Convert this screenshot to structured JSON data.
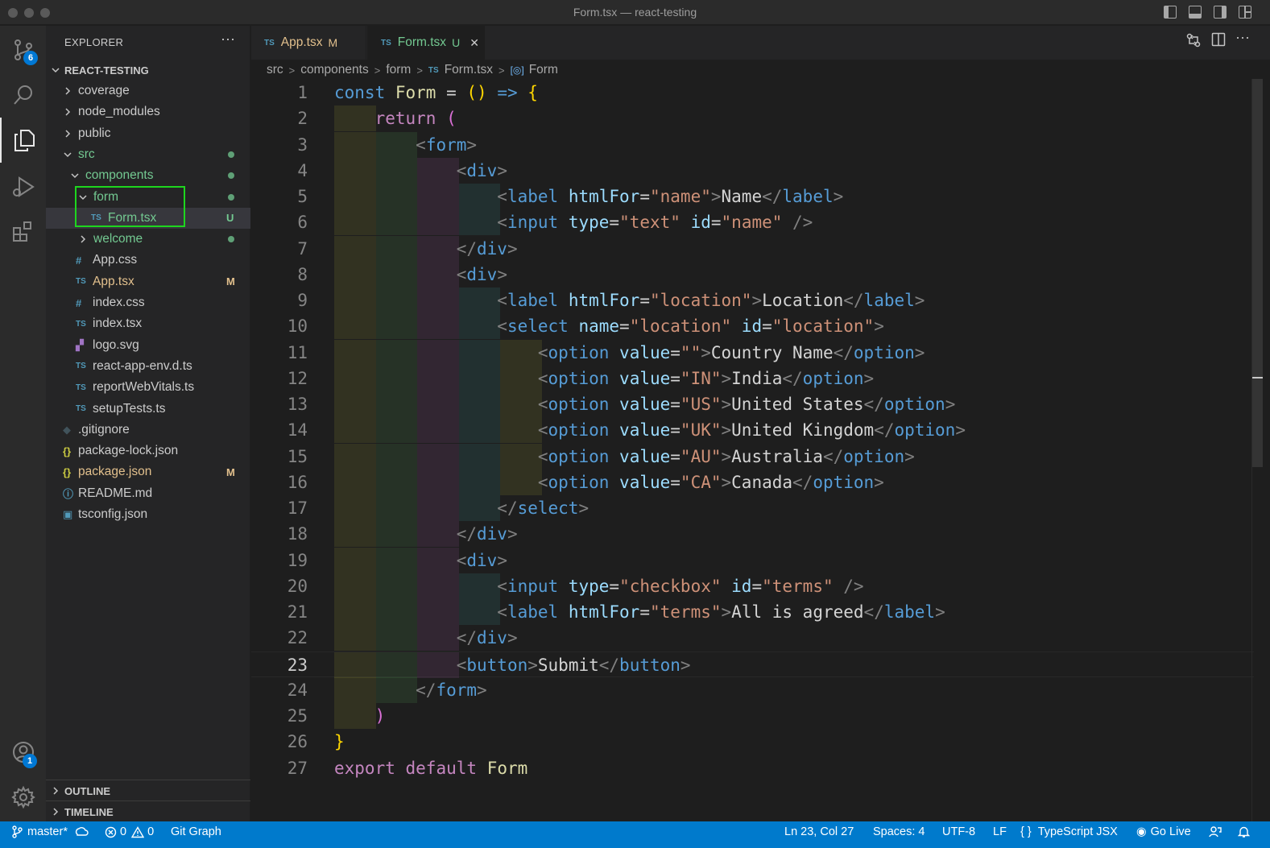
{
  "window": {
    "title": "Form.tsx — react-testing"
  },
  "activity_bar": {
    "items": [
      {
        "name": "source-control",
        "badge": "6"
      },
      {
        "name": "search"
      },
      {
        "name": "explorer"
      },
      {
        "name": "run-and-debug"
      },
      {
        "name": "extensions"
      },
      {
        "name": "accounts",
        "badge": "1"
      },
      {
        "name": "manage"
      }
    ]
  },
  "sidebar": {
    "header": "EXPLORER",
    "more": "···",
    "root": "REACT-TESTING",
    "tree": [
      {
        "label": "coverage",
        "type": "folder",
        "expanded": false,
        "depth": 1,
        "color": "#cccccc"
      },
      {
        "label": "node_modules",
        "type": "folder",
        "expanded": false,
        "depth": 1,
        "color": "#cccccc"
      },
      {
        "label": "public",
        "type": "folder",
        "expanded": false,
        "depth": 1,
        "color": "#cccccc"
      },
      {
        "label": "src",
        "type": "folder",
        "expanded": true,
        "depth": 1,
        "color": "#73c991",
        "dot": "#73c991"
      },
      {
        "label": "components",
        "type": "folder",
        "expanded": true,
        "depth": 2,
        "color": "#73c991",
        "dot": "#73c991"
      },
      {
        "label": "form",
        "type": "folder",
        "expanded": true,
        "depth": 3,
        "color": "#73c991",
        "dot": "#73c991"
      },
      {
        "label": "Form.tsx",
        "type": "ts",
        "depth": 4,
        "color": "#73c991",
        "status": "U",
        "status_color": "#73c991",
        "selected": true
      },
      {
        "label": "welcome",
        "type": "folder",
        "expanded": false,
        "depth": 3,
        "color": "#73c991",
        "dot": "#73c991"
      },
      {
        "label": "App.css",
        "type": "css",
        "depth": 2,
        "color": "#cccccc"
      },
      {
        "label": "App.tsx",
        "type": "ts",
        "depth": 2,
        "color": "#e2c08d",
        "status": "M",
        "status_color": "#e2c08d"
      },
      {
        "label": "index.css",
        "type": "css",
        "depth": 2,
        "color": "#cccccc"
      },
      {
        "label": "index.tsx",
        "type": "ts",
        "depth": 2,
        "color": "#cccccc"
      },
      {
        "label": "logo.svg",
        "type": "svg",
        "depth": 2,
        "color": "#cccccc"
      },
      {
        "label": "react-app-env.d.ts",
        "type": "ts",
        "depth": 2,
        "color": "#cccccc"
      },
      {
        "label": "reportWebVitals.ts",
        "type": "ts",
        "depth": 2,
        "color": "#cccccc"
      },
      {
        "label": "setupTests.ts",
        "type": "ts",
        "depth": 2,
        "color": "#cccccc"
      },
      {
        "label": ".gitignore",
        "type": "git",
        "depth": 1,
        "color": "#cccccc"
      },
      {
        "label": "package-lock.json",
        "type": "json",
        "depth": 1,
        "color": "#cccccc"
      },
      {
        "label": "package.json",
        "type": "json",
        "depth": 1,
        "color": "#e2c08d",
        "status": "M",
        "status_color": "#e2c08d"
      },
      {
        "label": "README.md",
        "type": "info",
        "depth": 1,
        "color": "#cccccc"
      },
      {
        "label": "tsconfig.json",
        "type": "tsconfig",
        "depth": 1,
        "color": "#cccccc"
      }
    ],
    "sections": [
      "OUTLINE",
      "TIMELINE"
    ]
  },
  "tabs": [
    {
      "label": "App.tsx",
      "icon": "TS",
      "status": "M",
      "color": "#e2c08d",
      "active": false
    },
    {
      "label": "Form.tsx",
      "icon": "TS",
      "status": "U",
      "color": "#73c991",
      "active": true,
      "close": "✕"
    }
  ],
  "breadcrumb": {
    "items": [
      "src",
      "components",
      "form",
      "Form.tsx",
      "Form"
    ]
  },
  "editor": {
    "current_line": 23,
    "lines": [
      {
        "n": "1",
        "indent": 0,
        "tokens": [
          [
            "const",
            "kw"
          ],
          [
            " ",
            "op"
          ],
          [
            "Form",
            "fn"
          ],
          [
            " = ",
            "op"
          ],
          [
            "()",
            "y"
          ],
          [
            " => ",
            "kw"
          ],
          [
            "{",
            "y"
          ]
        ]
      },
      {
        "n": "2",
        "indent": 1,
        "tokens": [
          [
            "return",
            "ctrl"
          ],
          [
            " ",
            "op"
          ],
          [
            "(",
            "p"
          ]
        ]
      },
      {
        "n": "3",
        "indent": 2,
        "tokens": [
          [
            "<",
            "br"
          ],
          [
            "form",
            "tag"
          ],
          [
            ">",
            "br"
          ]
        ]
      },
      {
        "n": "4",
        "indent": 3,
        "tokens": [
          [
            "<",
            "br"
          ],
          [
            "div",
            "tag"
          ],
          [
            ">",
            "br"
          ]
        ]
      },
      {
        "n": "5",
        "indent": 4,
        "tokens": [
          [
            "<",
            "br"
          ],
          [
            "label",
            "tag"
          ],
          [
            " ",
            "op"
          ],
          [
            "htmlFor",
            "at"
          ],
          [
            "=",
            "op"
          ],
          [
            "\"name\"",
            "str"
          ],
          [
            ">",
            "br"
          ],
          [
            "Name",
            "txt"
          ],
          [
            "</",
            "br"
          ],
          [
            "label",
            "tag"
          ],
          [
            ">",
            "br"
          ]
        ]
      },
      {
        "n": "6",
        "indent": 4,
        "tokens": [
          [
            "<",
            "br"
          ],
          [
            "input",
            "tag"
          ],
          [
            " ",
            "op"
          ],
          [
            "type",
            "at"
          ],
          [
            "=",
            "op"
          ],
          [
            "\"text\"",
            "str"
          ],
          [
            " ",
            "op"
          ],
          [
            "id",
            "at"
          ],
          [
            "=",
            "op"
          ],
          [
            "\"name\"",
            "str"
          ],
          [
            " />",
            "br"
          ]
        ]
      },
      {
        "n": "7",
        "indent": 3,
        "tokens": [
          [
            "</",
            "br"
          ],
          [
            "div",
            "tag"
          ],
          [
            ">",
            "br"
          ]
        ]
      },
      {
        "n": "8",
        "indent": 3,
        "tokens": [
          [
            "<",
            "br"
          ],
          [
            "div",
            "tag"
          ],
          [
            ">",
            "br"
          ]
        ]
      },
      {
        "n": "9",
        "indent": 4,
        "tokens": [
          [
            "<",
            "br"
          ],
          [
            "label",
            "tag"
          ],
          [
            " ",
            "op"
          ],
          [
            "htmlFor",
            "at"
          ],
          [
            "=",
            "op"
          ],
          [
            "\"location\"",
            "str"
          ],
          [
            ">",
            "br"
          ],
          [
            "Location",
            "txt"
          ],
          [
            "</",
            "br"
          ],
          [
            "label",
            "tag"
          ],
          [
            ">",
            "br"
          ]
        ]
      },
      {
        "n": "10",
        "indent": 4,
        "tokens": [
          [
            "<",
            "br"
          ],
          [
            "select",
            "tag"
          ],
          [
            " ",
            "op"
          ],
          [
            "name",
            "at"
          ],
          [
            "=",
            "op"
          ],
          [
            "\"location\"",
            "str"
          ],
          [
            " ",
            "op"
          ],
          [
            "id",
            "at"
          ],
          [
            "=",
            "op"
          ],
          [
            "\"location\"",
            "str"
          ],
          [
            ">",
            "br"
          ]
        ]
      },
      {
        "n": "11",
        "indent": 5,
        "tokens": [
          [
            "<",
            "br"
          ],
          [
            "option",
            "tag"
          ],
          [
            " ",
            "op"
          ],
          [
            "value",
            "at"
          ],
          [
            "=",
            "op"
          ],
          [
            "\"\"",
            "str"
          ],
          [
            ">",
            "br"
          ],
          [
            "Country Name",
            "txt"
          ],
          [
            "</",
            "br"
          ],
          [
            "option",
            "tag"
          ],
          [
            ">",
            "br"
          ]
        ]
      },
      {
        "n": "12",
        "indent": 5,
        "tokens": [
          [
            "<",
            "br"
          ],
          [
            "option",
            "tag"
          ],
          [
            " ",
            "op"
          ],
          [
            "value",
            "at"
          ],
          [
            "=",
            "op"
          ],
          [
            "\"IN\"",
            "str"
          ],
          [
            ">",
            "br"
          ],
          [
            "India",
            "txt"
          ],
          [
            "</",
            "br"
          ],
          [
            "option",
            "tag"
          ],
          [
            ">",
            "br"
          ]
        ]
      },
      {
        "n": "13",
        "indent": 5,
        "tokens": [
          [
            "<",
            "br"
          ],
          [
            "option",
            "tag"
          ],
          [
            " ",
            "op"
          ],
          [
            "value",
            "at"
          ],
          [
            "=",
            "op"
          ],
          [
            "\"US\"",
            "str"
          ],
          [
            ">",
            "br"
          ],
          [
            "United States",
            "txt"
          ],
          [
            "</",
            "br"
          ],
          [
            "option",
            "tag"
          ],
          [
            ">",
            "br"
          ]
        ]
      },
      {
        "n": "14",
        "indent": 5,
        "tokens": [
          [
            "<",
            "br"
          ],
          [
            "option",
            "tag"
          ],
          [
            " ",
            "op"
          ],
          [
            "value",
            "at"
          ],
          [
            "=",
            "op"
          ],
          [
            "\"UK\"",
            "str"
          ],
          [
            ">",
            "br"
          ],
          [
            "United Kingdom",
            "txt"
          ],
          [
            "</",
            "br"
          ],
          [
            "option",
            "tag"
          ],
          [
            ">",
            "br"
          ]
        ]
      },
      {
        "n": "15",
        "indent": 5,
        "tokens": [
          [
            "<",
            "br"
          ],
          [
            "option",
            "tag"
          ],
          [
            " ",
            "op"
          ],
          [
            "value",
            "at"
          ],
          [
            "=",
            "op"
          ],
          [
            "\"AU\"",
            "str"
          ],
          [
            ">",
            "br"
          ],
          [
            "Australia",
            "txt"
          ],
          [
            "</",
            "br"
          ],
          [
            "option",
            "tag"
          ],
          [
            ">",
            "br"
          ]
        ]
      },
      {
        "n": "16",
        "indent": 5,
        "tokens": [
          [
            "<",
            "br"
          ],
          [
            "option",
            "tag"
          ],
          [
            " ",
            "op"
          ],
          [
            "value",
            "at"
          ],
          [
            "=",
            "op"
          ],
          [
            "\"CA\"",
            "str"
          ],
          [
            ">",
            "br"
          ],
          [
            "Canada",
            "txt"
          ],
          [
            "</",
            "br"
          ],
          [
            "option",
            "tag"
          ],
          [
            ">",
            "br"
          ]
        ]
      },
      {
        "n": "17",
        "indent": 4,
        "tokens": [
          [
            "</",
            "br"
          ],
          [
            "select",
            "tag"
          ],
          [
            ">",
            "br"
          ]
        ]
      },
      {
        "n": "18",
        "indent": 3,
        "tokens": [
          [
            "</",
            "br"
          ],
          [
            "div",
            "tag"
          ],
          [
            ">",
            "br"
          ]
        ]
      },
      {
        "n": "19",
        "indent": 3,
        "tokens": [
          [
            "<",
            "br"
          ],
          [
            "div",
            "tag"
          ],
          [
            ">",
            "br"
          ]
        ]
      },
      {
        "n": "20",
        "indent": 4,
        "tokens": [
          [
            "<",
            "br"
          ],
          [
            "input",
            "tag"
          ],
          [
            " ",
            "op"
          ],
          [
            "type",
            "at"
          ],
          [
            "=",
            "op"
          ],
          [
            "\"checkbox\"",
            "str"
          ],
          [
            " ",
            "op"
          ],
          [
            "id",
            "at"
          ],
          [
            "=",
            "op"
          ],
          [
            "\"terms\"",
            "str"
          ],
          [
            " />",
            "br"
          ]
        ]
      },
      {
        "n": "21",
        "indent": 4,
        "tokens": [
          [
            "<",
            "br"
          ],
          [
            "label",
            "tag"
          ],
          [
            " ",
            "op"
          ],
          [
            "htmlFor",
            "at"
          ],
          [
            "=",
            "op"
          ],
          [
            "\"terms\"",
            "str"
          ],
          [
            ">",
            "br"
          ],
          [
            "All is agreed",
            "txt"
          ],
          [
            "</",
            "br"
          ],
          [
            "label",
            "tag"
          ],
          [
            ">",
            "br"
          ]
        ]
      },
      {
        "n": "22",
        "indent": 3,
        "tokens": [
          [
            "</",
            "br"
          ],
          [
            "div",
            "tag"
          ],
          [
            ">",
            "br"
          ]
        ]
      },
      {
        "n": "23",
        "indent": 3,
        "tokens": [
          [
            "<",
            "br"
          ],
          [
            "button",
            "tag"
          ],
          [
            ">",
            "br"
          ],
          [
            "Submit",
            "txt"
          ],
          [
            "</",
            "br"
          ],
          [
            "button",
            "tag"
          ],
          [
            ">",
            "br"
          ]
        ]
      },
      {
        "n": "24",
        "indent": 2,
        "tokens": [
          [
            "</",
            "br"
          ],
          [
            "form",
            "tag"
          ],
          [
            ">",
            "br"
          ]
        ]
      },
      {
        "n": "25",
        "indent": 1,
        "tokens": [
          [
            ")",
            "p"
          ]
        ]
      },
      {
        "n": "26",
        "indent": 0,
        "tokens": [
          [
            "}",
            "y"
          ]
        ]
      },
      {
        "n": "27",
        "indent": 0,
        "tokens": [
          [
            "export",
            "ctrl"
          ],
          [
            " ",
            "op"
          ],
          [
            "default",
            "ctrl"
          ],
          [
            " ",
            "op"
          ],
          [
            "Form",
            "fn"
          ]
        ]
      }
    ],
    "indent_colors": [
      "rgba(255,255,64,0.09)",
      "rgba(127,255,127,0.09)",
      "rgba(255,127,255,0.09)",
      "rgba(79,236,236,0.09)",
      "rgba(255,255,64,0.09)"
    ]
  },
  "statusbar": {
    "branch": "master*",
    "errors": "0",
    "warnings": "0",
    "git_graph": "Git Graph",
    "position": "Ln 23, Col 27",
    "spaces": "Spaces: 4",
    "encoding": "UTF-8",
    "eol": "LF",
    "language": "TypeScript JSX",
    "go_live": "Go Live"
  },
  "colors": {
    "accent": "#007acc",
    "modified": "#e2c08d",
    "untracked": "#73c991",
    "highlight_box": "#1ed61e"
  }
}
